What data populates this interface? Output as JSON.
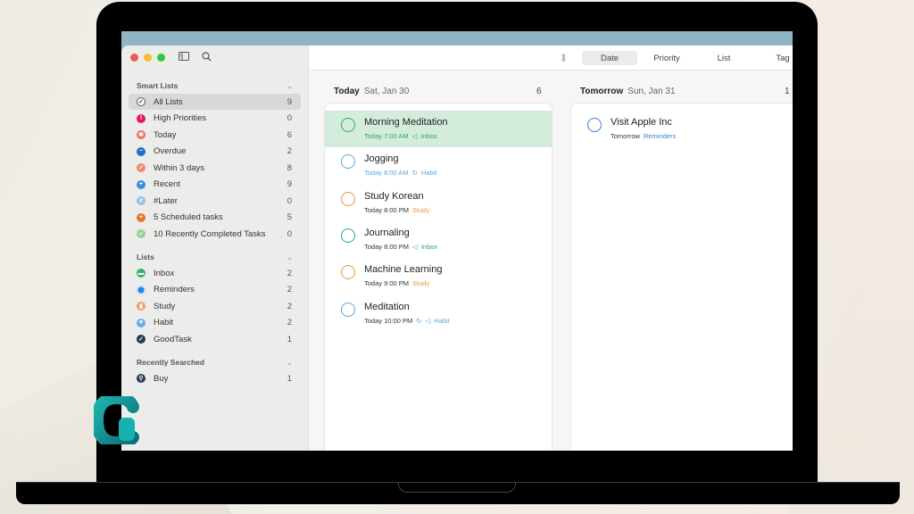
{
  "window": {
    "traffic_lights": [
      "close",
      "minimize",
      "zoom"
    ],
    "toolbar_icons": [
      "sidebar-toggle-icon",
      "search-icon"
    ]
  },
  "sidebar": {
    "smart_lists": {
      "header": "Smart Lists",
      "items": [
        {
          "label": "All Lists",
          "count": "9",
          "icon": "checkmark-circle-icon",
          "color": "#ffffff",
          "selected": true
        },
        {
          "label": "High Priorities",
          "count": "0",
          "icon": "exclamation-icon",
          "color": "#e8175d"
        },
        {
          "label": "Today",
          "count": "6",
          "icon": "star-icon",
          "color": "#e8735c"
        },
        {
          "label": "Overdue",
          "count": "2",
          "icon": "wave-icon",
          "color": "#1f6fc5"
        },
        {
          "label": "Within 3 days",
          "count": "8",
          "icon": "check-icon",
          "color": "#f08a6c"
        },
        {
          "label": "Recent",
          "count": "9",
          "icon": "plus-icon",
          "color": "#3d8ee0"
        },
        {
          "label": "#Later",
          "count": "0",
          "icon": "hash-icon",
          "color": "#8fc0ec"
        },
        {
          "label": "5 Scheduled tasks",
          "count": "5",
          "icon": "plus-icon",
          "color": "#e8732a"
        },
        {
          "label": "10 Recently Completed Tasks",
          "count": "0",
          "icon": "check-icon",
          "color": "#8fd39a"
        }
      ]
    },
    "lists": {
      "header": "Lists",
      "items": [
        {
          "label": "Inbox",
          "count": "2",
          "icon": "inbox-icon",
          "color": "#2fb56a"
        },
        {
          "label": "Reminders",
          "count": "2",
          "icon": "dot-icon",
          "color": "#1a84f0"
        },
        {
          "label": "Study",
          "count": "2",
          "icon": "book-icon",
          "color": "#f0a060"
        },
        {
          "label": "Habit",
          "count": "2",
          "icon": "heart-icon",
          "color": "#6aaeea"
        },
        {
          "label": "GoodTask",
          "count": "1",
          "icon": "check-icon",
          "color": "#2a3a52"
        }
      ]
    },
    "recently_searched": {
      "header": "Recently Searched",
      "items": [
        {
          "label": "Buy",
          "count": "1",
          "icon": "search-icon",
          "color": "#2a3a52"
        }
      ]
    }
  },
  "toolbar": {
    "view_icon": "columns-icon",
    "segments": [
      {
        "label": "Date",
        "active": true
      },
      {
        "label": "Priority",
        "active": false
      },
      {
        "label": "List",
        "active": false
      },
      {
        "label": "Tag",
        "active": false
      }
    ]
  },
  "columns": [
    {
      "day": "Today",
      "date": "Sat, Jan 30",
      "count": "6",
      "tasks": [
        {
          "title": "Morning Meditation",
          "when": "Today 7:00 AM",
          "repeat": false,
          "list_icon": true,
          "list": "Inbox",
          "color": "#2fa86a",
          "selected": true
        },
        {
          "title": "Jogging",
          "when": "Today 8:00 AM",
          "repeat": true,
          "list_icon": false,
          "list": "Habit",
          "color": "#5aa6e2",
          "selected": false
        },
        {
          "title": "Study Korean",
          "when": "Today 8:00 PM",
          "repeat": false,
          "list_icon": false,
          "list": "Study",
          "color": "#e8963f",
          "selected": false
        },
        {
          "title": "Journaling",
          "when": "Today 8:00 PM",
          "repeat": false,
          "list_icon": true,
          "list": "Inbox",
          "color": "#2fa86a",
          "selected": false
        },
        {
          "title": "Machine Learning",
          "when": "Today 9:00 PM",
          "repeat": false,
          "list_icon": false,
          "list": "Study",
          "color": "#e8963f",
          "selected": false
        },
        {
          "title": "Meditation",
          "when": "Today 10:00 PM",
          "repeat": true,
          "list_icon": true,
          "list": "Habit",
          "color": "#5aa6e2",
          "selected": false
        }
      ]
    },
    {
      "day": "Tomorrow",
      "date": "Sun, Jan 31",
      "count": "1",
      "tasks": [
        {
          "title": "Visit Apple Inc",
          "when": "Tomorrow",
          "repeat": false,
          "list_icon": false,
          "list": "Reminders",
          "color": "#2f7fd6",
          "selected": false
        }
      ]
    }
  ],
  "symbols": {
    "repeat": "↻",
    "inbox": "◁"
  },
  "watermark": "logo-icon"
}
